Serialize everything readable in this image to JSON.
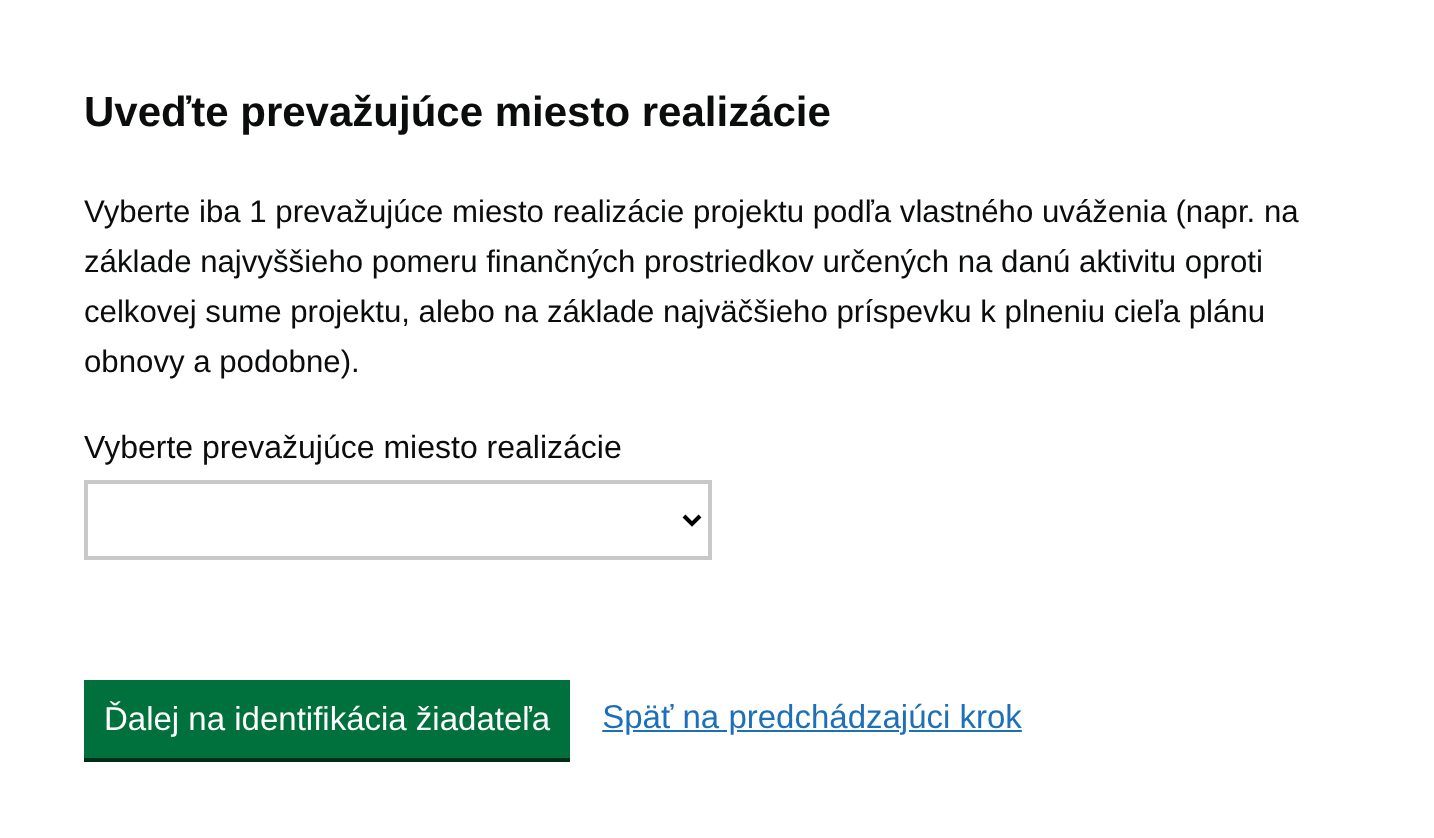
{
  "heading": "Uveďte prevažujúce miesto realizácie",
  "description": "Vyberte iba 1 prevažujúce miesto realizácie projektu podľa vlastného uváženia (napr. na základe najvyššieho pomeru finančných prostriedkov určených na danú aktivitu oproti celkovej sume projektu, alebo na základe najväčšieho príspevku k plneniu cieľa plánu obnovy a podobne).",
  "select": {
    "label": "Vyberte prevažujúce miesto realizácie"
  },
  "primary_button": "Ďalej na identifikácia žiadateľa",
  "back_link": "Späť na predchádzajúci krok"
}
